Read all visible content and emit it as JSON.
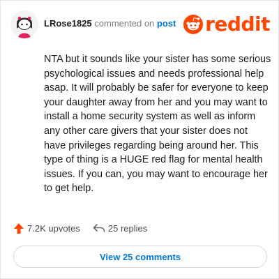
{
  "post": {
    "username": "LRose1825",
    "action_text": "commented on",
    "target_text": "post",
    "avatar_icon": "user-avatar-icon",
    "body": "NTA but it sounds like your sister has some serious psychological issues and needs professional help asap. It will probably be safer for everyone to keep your daughter away from her and you may want to install a home security system as well as inform any other care givers that your sister does not have privileges regarding being around her. This type of thing is a HUGE red flag for mental health issues. If you can, you may want to encourage her to get help."
  },
  "brand": {
    "name": "reddit",
    "logo_icon": "reddit-snoo-icon",
    "color": "#ff4500"
  },
  "stats": {
    "upvotes": "7.2K upvotes",
    "upvote_icon": "upvote-arrow-icon",
    "upvote_color": "#ff4500",
    "replies": "25 replies",
    "reply_icon": "reply-arrow-icon"
  },
  "footer": {
    "view_comments": "View 25 comments",
    "link_color": "#0079d3"
  }
}
